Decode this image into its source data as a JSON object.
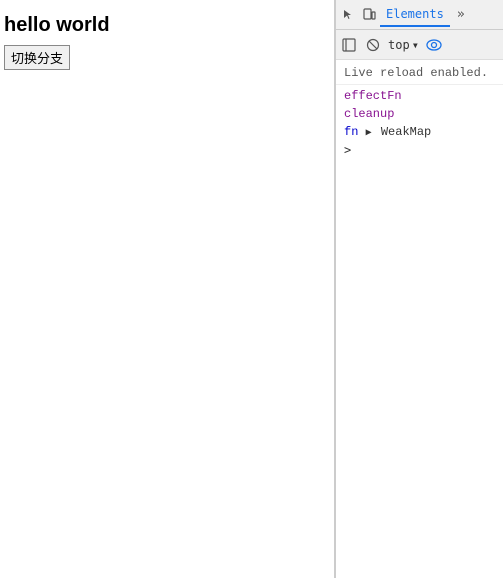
{
  "viewport": {
    "title": "hello world",
    "button_label": "切换分支"
  },
  "devtools": {
    "tabs": [
      {
        "label": "Elements",
        "active": true
      },
      {
        "label": "⋯",
        "active": false
      }
    ],
    "toolbar": {
      "top_label": "top",
      "dropdown_arrow": "▾"
    },
    "console_lines": [
      {
        "text": "Live reload enabled.",
        "type": "reload"
      },
      {
        "prop": "effectFn",
        "type": "prop"
      },
      {
        "prop": "cleanup",
        "type": "prop"
      },
      {
        "fn": "fn",
        "arrow": "▶",
        "cls": "WeakMap",
        "type": "fn"
      }
    ],
    "expand_caret": ">"
  }
}
